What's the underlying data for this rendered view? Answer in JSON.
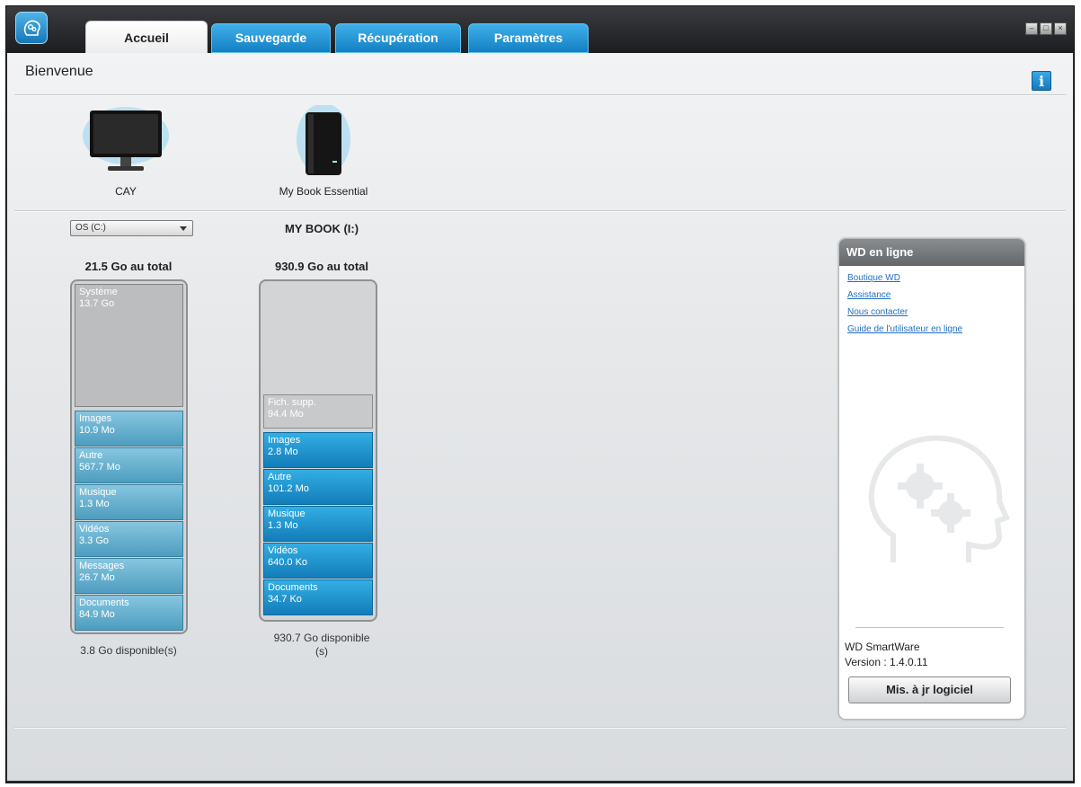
{
  "tabs": [
    {
      "label": "Accueil",
      "active": true
    },
    {
      "label": "Sauvegarde",
      "active": false
    },
    {
      "label": "Récupération",
      "active": false
    },
    {
      "label": "Paramètres",
      "active": false
    }
  ],
  "header": {
    "title": "Bienvenue",
    "info_icon": "i"
  },
  "devices": [
    {
      "label": "CAY",
      "icon": "monitor-icon"
    },
    {
      "label": "My Book Essential",
      "icon": "external-drive-icon"
    }
  ],
  "local_drive": {
    "select_value": "OS (C:)",
    "total": "21.5 Go au total",
    "used_block": {
      "name": "Système",
      "size": "13.7 Go"
    },
    "segments": [
      {
        "name": "Images",
        "size": "10.9 Mo"
      },
      {
        "name": "Autre",
        "size": "567.7 Mo"
      },
      {
        "name": "Musique",
        "size": "1.3 Mo"
      },
      {
        "name": "Vidéos",
        "size": "3.3 Go"
      },
      {
        "name": "Messages",
        "size": "26.7 Mo"
      },
      {
        "name": "Documents",
        "size": "84.9 Mo"
      }
    ],
    "available": "3.8 Go disponible(s)"
  },
  "external_drive": {
    "title": "MY BOOK (I:)",
    "total": "930.9 Go au total",
    "supp_block": {
      "name": "Fich. supp.",
      "size": "94.4 Mo"
    },
    "segments": [
      {
        "name": "Images",
        "size": "2.8 Mo"
      },
      {
        "name": "Autre",
        "size": "101.2 Mo"
      },
      {
        "name": "Musique",
        "size": "1.3 Mo"
      },
      {
        "name": "Vidéos",
        "size": "640.0 Ko"
      },
      {
        "name": "Documents",
        "size": "34.7 Ko"
      }
    ],
    "available_line1": "930.7 Go disponible",
    "available_line2": "(s)"
  },
  "wd_panel": {
    "title": "WD en ligne",
    "links": [
      "Boutique WD",
      "Assistance",
      "Nous contacter",
      "Guide de l'utilisateur en ligne"
    ],
    "product": "WD SmartWare",
    "version": "Version : 1.4.0.11",
    "update_button": "Mis. à jr logiciel"
  },
  "colors": {
    "tab_blue": "#1a8fd2",
    "segment_light": "#6fb3d2",
    "segment_bright": "#1d93d0"
  }
}
